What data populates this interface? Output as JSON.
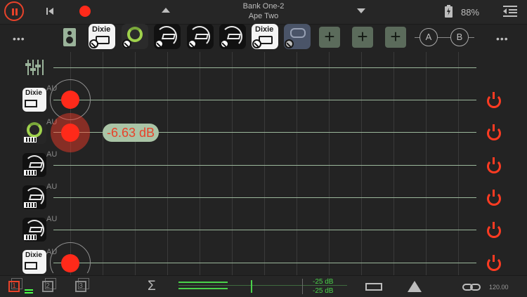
{
  "header": {
    "bank_title": "Bank One-2",
    "bank_subtitle": "Ape Two",
    "battery_percent": "88%",
    "battery_level": 0.88
  },
  "slots": {
    "left_menu": "•••",
    "right_menu": "•••",
    "plugins": [
      {
        "label": "Dixie",
        "kind": "dixie"
      },
      {
        "label": "",
        "kind": "loop"
      },
      {
        "label": "",
        "kind": "dark"
      },
      {
        "label": "",
        "kind": "dark"
      },
      {
        "label": "",
        "kind": "dark"
      },
      {
        "label": "Dixie",
        "kind": "dixie"
      },
      {
        "label": "",
        "kind": "faded"
      }
    ],
    "add_buttons": [
      "+",
      "+",
      "+"
    ],
    "scene_a": "A",
    "scene_b": "B"
  },
  "tracks": [
    {
      "icon": "dixie",
      "icon_text": "Dixie",
      "format": "AU",
      "enabled": true
    },
    {
      "icon": "loop",
      "icon_text": "",
      "format": "AU",
      "enabled": true
    },
    {
      "icon": "dark",
      "icon_text": "",
      "format": "AU",
      "enabled": true
    },
    {
      "icon": "dark",
      "icon_text": "",
      "format": "AU",
      "enabled": true
    },
    {
      "icon": "dark",
      "icon_text": "",
      "format": "AU",
      "enabled": true
    },
    {
      "icon": "dixie",
      "icon_text": "Dixie",
      "format": "AU",
      "enabled": true
    }
  ],
  "volume_readout": "-6.63 dB",
  "bottom": {
    "pages": [
      "1",
      "2",
      "3"
    ],
    "active_page": "1",
    "sigma": "Σ",
    "db_top": "-25 dB",
    "db_bottom": "-25 dB",
    "tempo": "120.00"
  },
  "colors": {
    "accent_red": "#ff2a1a",
    "grid_green": "#9bb79b",
    "meter_green": "#4ad24a",
    "bubble": "#aac4a6"
  }
}
